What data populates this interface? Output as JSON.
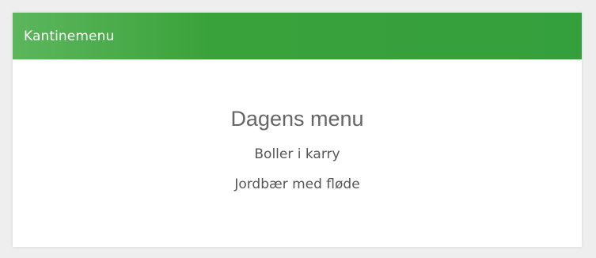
{
  "widget": {
    "title": "Kantinemenu"
  },
  "menu": {
    "heading": "Dagens menu",
    "items": [
      "Boller i karry",
      "Jordbær med fløde"
    ]
  },
  "colors": {
    "header": "#349f3d",
    "background": "#eeeeee",
    "card": "#ffffff"
  }
}
